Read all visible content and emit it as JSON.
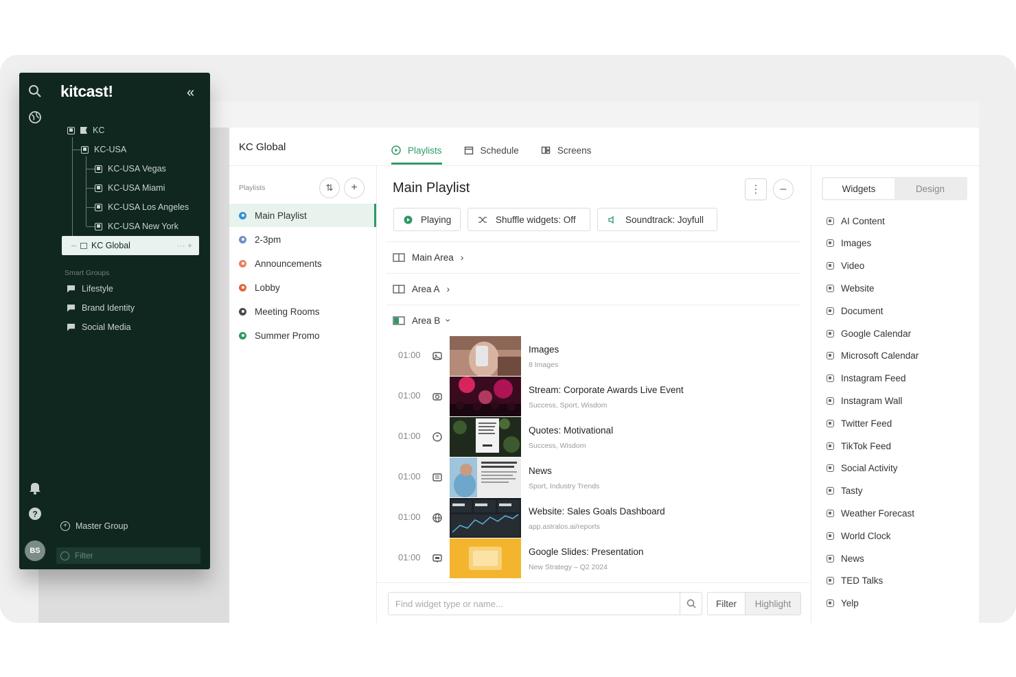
{
  "brand": {
    "logo": "kitcast!"
  },
  "tree": {
    "root": "KC",
    "region": "KC-USA",
    "locations": [
      "KC-USA Vegas",
      "KC-USA Miami",
      "KC-USA Los Angeles",
      "KC-USA New York"
    ],
    "selected": "KC Global",
    "selected_actions": "··· +"
  },
  "smart_groups": {
    "label": "Smart Groups",
    "items": [
      "Lifestyle",
      "Brand Identity",
      "Social Media"
    ]
  },
  "sidebar_footer": {
    "master_group": "Master Group",
    "filter_placeholder": "Filter",
    "avatar_initials": "BS"
  },
  "header": {
    "org_title": "KC Global",
    "tabs": [
      {
        "label": "Playlists",
        "active": true
      },
      {
        "label": "Schedule",
        "active": false
      },
      {
        "label": "Screens",
        "active": false
      }
    ]
  },
  "playlists": {
    "label": "Playlists",
    "items": [
      {
        "name": "Main Playlist",
        "color": "#3a8fd6",
        "active": true
      },
      {
        "name": "2-3pm",
        "color": "#6f8fc8",
        "active": false
      },
      {
        "name": "Announcements",
        "color": "#e8805f",
        "active": false
      },
      {
        "name": "Lobby",
        "color": "#e0663a",
        "active": false
      },
      {
        "name": "Meeting Rooms",
        "color": "#4a4a4a",
        "active": false
      },
      {
        "name": "Summer Promo",
        "color": "#2e9a66",
        "active": false
      }
    ]
  },
  "main": {
    "title": "Main Playlist",
    "pills": {
      "playing": "Playing",
      "shuffle": "Shuffle widgets: Off",
      "soundtrack": "Soundtrack: Joyfull"
    },
    "areas": [
      "Main Area",
      "Area A",
      "Area B"
    ],
    "widgets": [
      {
        "time": "01:00",
        "name": "Images",
        "sub": "8 Images",
        "icon": "image-icon"
      },
      {
        "time": "01:00",
        "name": "Stream: Corporate Awards Live Event",
        "sub": "Success, Sport, Wisdom",
        "icon": "camera-icon"
      },
      {
        "time": "01:00",
        "name": "Quotes: Motivational",
        "sub": "Success, Wisdom",
        "icon": "quote-icon"
      },
      {
        "time": "01:00",
        "name": "News",
        "sub": "Sport, Industry Trends",
        "icon": "news-icon"
      },
      {
        "time": "01:00",
        "name": "Website: Sales Goals Dashboard",
        "sub": "app.astralos.ai/reports",
        "icon": "globe-icon"
      },
      {
        "time": "01:00",
        "name": "Google Slides: Presentation",
        "sub": "New Strategy – Q2 2024",
        "icon": "slides-icon"
      }
    ],
    "search_placeholder": "Find widget type or name...",
    "filter_label": "Filter",
    "highlight_label": "Highlight"
  },
  "right_panel": {
    "tabs": {
      "widgets": "Widgets",
      "design": "Design"
    },
    "items": [
      "AI Content",
      "Images",
      "Video",
      "Website",
      "Document",
      "Google Calendar",
      "Microsoft Calendar",
      "Instagram Feed",
      "Instagram Wall",
      "Twitter Feed",
      "TikTok Feed",
      "Social Activity",
      "Tasty",
      "Weather Forecast",
      "World Clock",
      "News",
      "TED Talks",
      "Yelp"
    ]
  },
  "colors": {
    "sidebar_bg": "#10271f",
    "accent": "#2e9a66"
  }
}
